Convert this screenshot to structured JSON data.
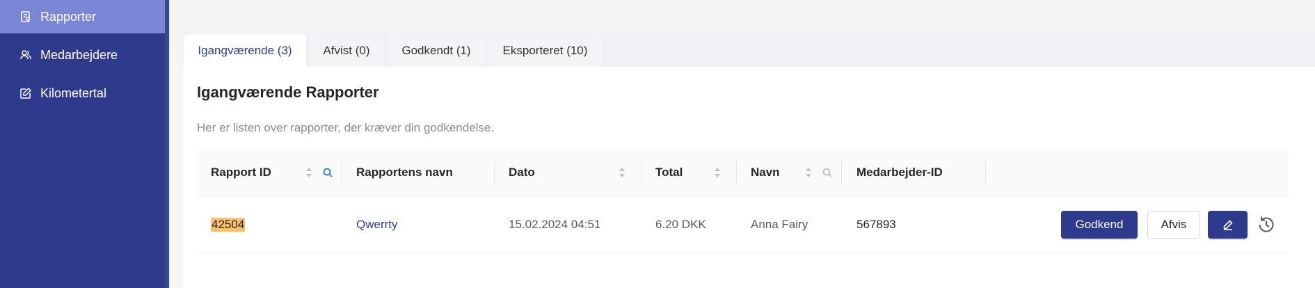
{
  "sidebar": {
    "items": [
      {
        "label": "Rapporter",
        "icon": "report-icon",
        "active": true
      },
      {
        "label": "Medarbejdere",
        "icon": "users-icon",
        "active": false
      },
      {
        "label": "Kilometertal",
        "icon": "edit-icon",
        "active": false
      }
    ]
  },
  "tabs": [
    {
      "label": "Igangværende (3)",
      "active": true
    },
    {
      "label": "Afvist (0)",
      "active": false
    },
    {
      "label": "Godkendt (1)",
      "active": false
    },
    {
      "label": "Eksporteret (10)",
      "active": false
    }
  ],
  "main": {
    "title": "Igangværende Rapporter",
    "subtitle": "Her er listen over rapporter, der kræver din godkendelse."
  },
  "table": {
    "columns": [
      "Rapport ID",
      "Rapportens navn",
      "Dato",
      "Total",
      "Navn",
      "Medarbejder-ID"
    ],
    "rows": [
      {
        "id": "42504",
        "name": "Qwerrty",
        "date": "15.02.2024 04:51",
        "total": "6.20 DKK",
        "person": "Anna Fairy",
        "employee_id": "567893"
      }
    ]
  },
  "actions": {
    "approve": "Godkend",
    "reject": "Afvis"
  },
  "colors": {
    "primary": "#2e3a8c",
    "sidebar_active": "#7b86d6",
    "highlight": "#ffc069"
  }
}
